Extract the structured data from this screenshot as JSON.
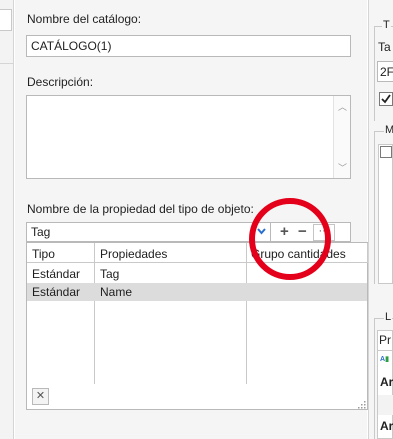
{
  "catalog": {
    "name_label": "Nombre del catálogo:",
    "name_value": "CATÁLOGO(1)",
    "description_label": "Descripción:",
    "description_value": ""
  },
  "property": {
    "label": "Nombre de la propiedad del tipo de objeto:",
    "selected": "Tag",
    "add_glyph": "+",
    "remove_glyph": "−",
    "more_glyph": "···"
  },
  "grid": {
    "columns": [
      "Tipo",
      "Propiedades",
      "Grupo cantidades"
    ],
    "rows": [
      {
        "tipo": "Estándar",
        "propiedad": "Tag",
        "grupo": ""
      },
      {
        "tipo": "Estándar",
        "propiedad": "Name",
        "grupo": ""
      }
    ],
    "delete_glyph": "✕"
  },
  "right_panel": {
    "t_label": "T",
    "ta_label": "Ta",
    "field_value": "2F",
    "m_label": "M",
    "l_label": "L",
    "pr_label": "Pr",
    "ar1": "Ar",
    "ar2": "Ar"
  },
  "colors": {
    "highlight_circle": "#e4001b",
    "selected_row": "#dcdcdc",
    "accent": "#2a6fcf"
  }
}
